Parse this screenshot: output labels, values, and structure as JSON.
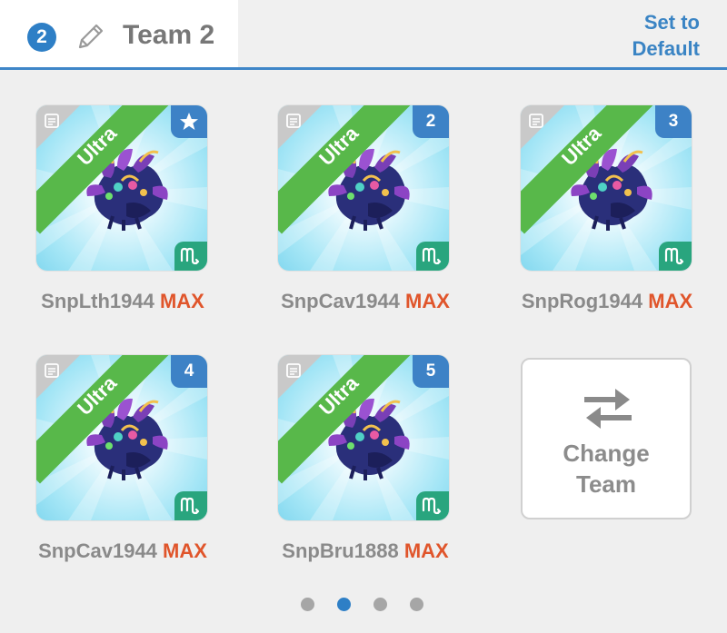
{
  "header": {
    "team_number": "2",
    "title": "Team 2",
    "set_default_line1": "Set to",
    "set_default_line2": "Default"
  },
  "cards": [
    {
      "rarity": "Ultra",
      "slot": "star",
      "name": "SnpLth1944",
      "level": "MAX"
    },
    {
      "rarity": "Ultra",
      "slot": "2",
      "name": "SnpCav1944",
      "level": "MAX"
    },
    {
      "rarity": "Ultra",
      "slot": "3",
      "name": "SnpRog1944",
      "level": "MAX"
    },
    {
      "rarity": "Ultra",
      "slot": "4",
      "name": "SnpCav1944",
      "level": "MAX"
    },
    {
      "rarity": "Ultra",
      "slot": "5",
      "name": "SnpBru1888",
      "level": "MAX"
    }
  ],
  "change_team": {
    "line1": "Change",
    "line2": "Team"
  },
  "pagination": {
    "pages": 4,
    "active": 2
  },
  "icons": {
    "card_top_left": "document-icon",
    "card_bottom_right": "scorpio-zodiac-icon",
    "leader_slot": "star-icon",
    "edit": "pencil-icon",
    "change_team": "swap-arrows-icon"
  },
  "colors": {
    "accent": "#2e7fc6",
    "ribbon": "#58b84a",
    "level": "#e0552b",
    "zodiac": "#29a57e"
  }
}
